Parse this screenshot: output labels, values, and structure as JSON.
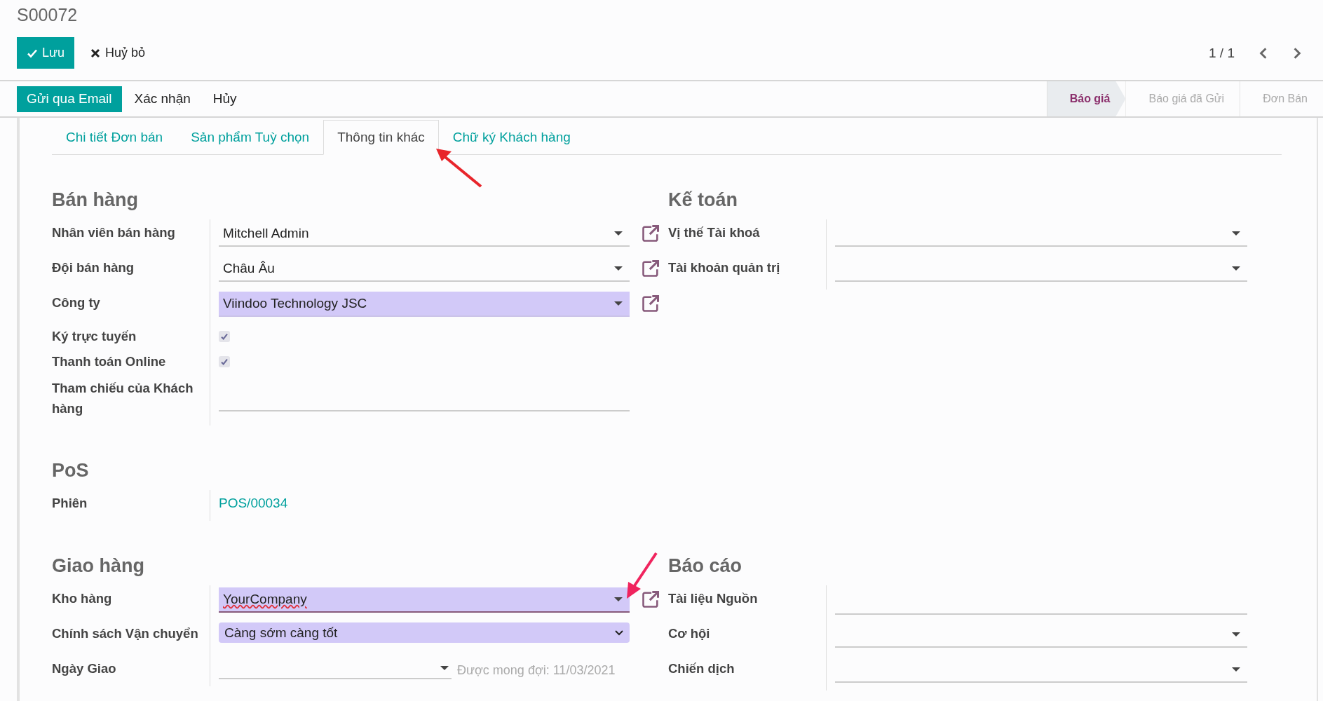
{
  "record_title": "S00072",
  "control_buttons": [
    {
      "label": "Lưu",
      "kind": "save"
    },
    {
      "label": "Huỷ bỏ",
      "kind": "discard"
    }
  ],
  "pager": "1 / 1",
  "action_buttons": [
    {
      "label": "Gửi qua Email",
      "kind": "primary"
    },
    {
      "label": "Xác nhận",
      "kind": "plain"
    },
    {
      "label": "Hủy",
      "kind": "plain"
    }
  ],
  "status_steps": [
    {
      "label": "Báo giá",
      "selected": true
    },
    {
      "label": "Báo giá đã Gửi",
      "selected": false
    },
    {
      "label": "Đơn Bán",
      "selected": false
    }
  ],
  "tabs": [
    {
      "label": "Chi tiết Đơn bán",
      "selected": false
    },
    {
      "label": "Sản phẩm Tuỳ chọn",
      "selected": false
    },
    {
      "label": "Thông tin khác",
      "selected": true
    },
    {
      "label": "Chữ ký Khách hàng",
      "selected": false
    }
  ],
  "rows": [
    {
      "groups": [
        {
          "title": "Bán hàng",
          "fields": [
            {
              "label": "Nhân viên bán hàng",
              "kind": "select",
              "value": "Mitchell Admin",
              "required": false,
              "focused": false,
              "external_link": true
            },
            {
              "label": "Đội bán hàng",
              "kind": "select",
              "value": "Châu Âu",
              "required": false,
              "focused": false,
              "external_link": true
            },
            {
              "label": "Công ty",
              "kind": "select",
              "value": "Viindoo Technology JSC",
              "required": true,
              "focused": false,
              "external_link": true
            },
            {
              "label": "Ký trực tuyến",
              "kind": "checkbox",
              "checked": true
            },
            {
              "label": "Thanh toán Online",
              "kind": "checkbox",
              "checked": true
            },
            {
              "label": "Tham chiếu của Khách hàng",
              "kind": "text"
            }
          ]
        },
        {
          "title": "Kế toán",
          "fields": [
            {
              "label": "Vị thế Tài khoá",
              "kind": "select",
              "required": false,
              "focused": false
            },
            {
              "label": "Tài khoản quản trị",
              "kind": "select",
              "required": false,
              "focused": false
            }
          ]
        }
      ]
    },
    {
      "groups": [
        {
          "title": "PoS",
          "fields": [
            {
              "label": "Phiên",
              "kind": "link",
              "value": "POS/00034"
            }
          ]
        }
      ]
    },
    {
      "groups": [
        {
          "title": "Giao hàng",
          "fields": [
            {
              "label": "Kho hàng",
              "kind": "select",
              "value": "YourCompany",
              "required": true,
              "focused": true,
              "external_link": true
            },
            {
              "label": "Chính sách Vận chuyển",
              "kind": "dropdown",
              "value": "Càng sớm càng tốt",
              "required": true
            },
            {
              "label": "Ngày Giao",
              "kind": "date",
              "hint": "Được mong đợi: 11/03/2021"
            }
          ]
        },
        {
          "title": "Báo cáo",
          "fields": [
            {
              "label": "Tài liệu Nguồn",
              "kind": "text"
            },
            {
              "label": "Cơ hội",
              "kind": "select",
              "required": false,
              "focused": false
            },
            {
              "label": "Chiến dịch",
              "kind": "select",
              "required": false,
              "focused": false
            }
          ]
        }
      ]
    }
  ]
}
